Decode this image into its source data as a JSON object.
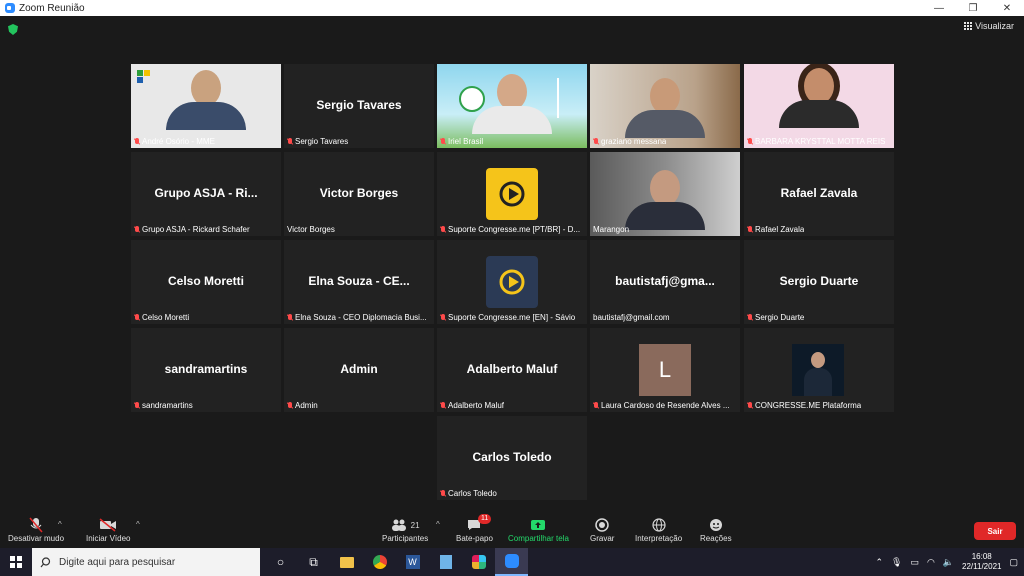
{
  "window": {
    "title": "Zoom Reunião",
    "minimize": "—",
    "restore": "❐",
    "close": "✕"
  },
  "view_button": {
    "label": "Visualizar"
  },
  "participants": [
    {
      "display": "",
      "label": "André Osório - MME",
      "muted": true,
      "video": true
    },
    {
      "display": "Sergio Tavares",
      "label": "Sergio Tavares",
      "muted": true,
      "video": false
    },
    {
      "display": "",
      "label": "Iriel Brasil",
      "muted": true,
      "video": true
    },
    {
      "display": "",
      "label": "graziano messana",
      "muted": true,
      "video": true
    },
    {
      "display": "",
      "label": "BARBARA KRYSTTAL MOTTA REIS",
      "muted": true,
      "video": true
    },
    {
      "display": "Grupo ASJA - Ri...",
      "label": "Grupo ASJA - Rickard Schafer",
      "muted": true,
      "video": false
    },
    {
      "display": "Victor Borges",
      "label": "Victor Borges",
      "muted": false,
      "video": false
    },
    {
      "display": "",
      "label": "Suporte Congresse.me [PT/BR] - D...",
      "muted": true,
      "video": false
    },
    {
      "display": "",
      "label": "Marangon",
      "muted": false,
      "video": true
    },
    {
      "display": "Rafael Zavala",
      "label": "Rafael Zavala",
      "muted": true,
      "video": false
    },
    {
      "display": "Celso Moretti",
      "label": "Celso Moretti",
      "muted": true,
      "video": false
    },
    {
      "display": "Elna Souza - CE...",
      "label": "Elna Souza - CEO Diplomacia Busi...",
      "muted": true,
      "video": false
    },
    {
      "display": "",
      "label": "Suporte Congresse.me [EN] - Sávio",
      "muted": true,
      "video": false
    },
    {
      "display": "bautistafj@gma...",
      "label": "bautistafj@gmail.com",
      "muted": false,
      "video": false
    },
    {
      "display": "Sergio Duarte",
      "label": "Sergio Duarte",
      "muted": true,
      "video": false
    },
    {
      "display": "sandramartins",
      "label": "sandramartins",
      "muted": true,
      "video": false
    },
    {
      "display": "Admin",
      "label": "Admin",
      "muted": true,
      "video": false
    },
    {
      "display": "Adalberto Maluf",
      "label": "Adalberto Maluf",
      "muted": true,
      "video": false
    },
    {
      "display": "L",
      "label": "Laura Cardoso de Resende Alves ...",
      "muted": true,
      "video": false
    },
    {
      "display": "",
      "label": "CONGRESSE.ME Plataforma",
      "muted": true,
      "video": false
    },
    {
      "display": "Carlos Toledo",
      "label": "Carlos Toledo",
      "muted": true,
      "video": false
    }
  ],
  "toolbar": {
    "mute": "Desativar mudo",
    "video": "Iniciar Vídeo",
    "participants": "Participantes",
    "participants_count": "21",
    "chat": "Bate-papo",
    "chat_badge": "11",
    "share": "Compartilhar tela",
    "record": "Gravar",
    "interpretation": "Interpretação",
    "reactions": "Reações",
    "leave": "Sair"
  },
  "taskbar": {
    "search_placeholder": "Digite aqui para pesquisar",
    "time": "16:08",
    "date": "22/11/2021"
  },
  "colors": {
    "active_speaker": "#c8e04a",
    "leave": "#e02828",
    "share": "#23d96a"
  }
}
